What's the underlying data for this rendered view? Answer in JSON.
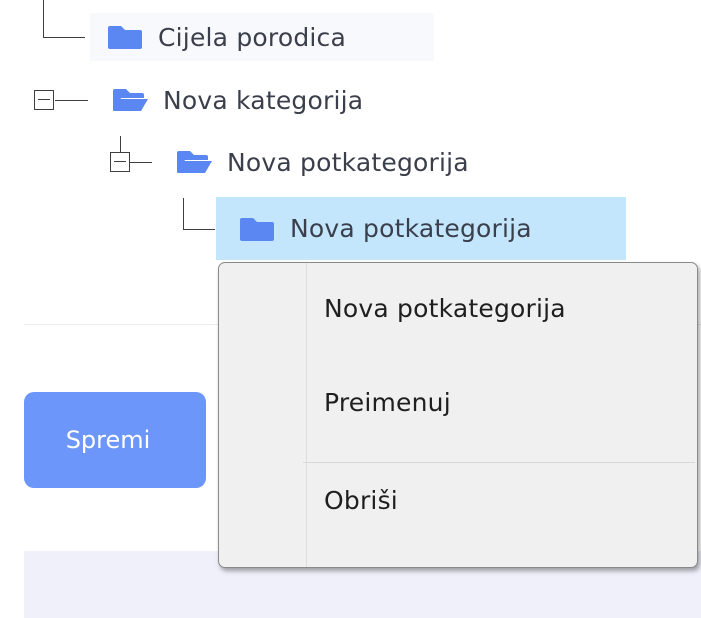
{
  "tree": {
    "nodes": [
      {
        "label": "Cijela porodica",
        "icon": "folder-closed-icon",
        "expanded": false
      },
      {
        "label": "Nova kategorija",
        "icon": "folder-open-icon",
        "expanded": true
      },
      {
        "label": "Nova potkategorija",
        "icon": "folder-open-icon",
        "expanded": true
      },
      {
        "label": "Nova potkategorija",
        "icon": "folder-closed-icon",
        "selected": true
      }
    ]
  },
  "context_menu": {
    "items": [
      {
        "label": "Nova potkategorija"
      },
      {
        "label": "Preimenuj"
      },
      {
        "label": "Obriši"
      }
    ]
  },
  "actions": {
    "save_label": "Spremi"
  },
  "colors": {
    "folder": "#5b87f3",
    "selection": "#c3e6fc",
    "save_button": "#6c96fa",
    "menu_background": "#f0f0f0"
  }
}
